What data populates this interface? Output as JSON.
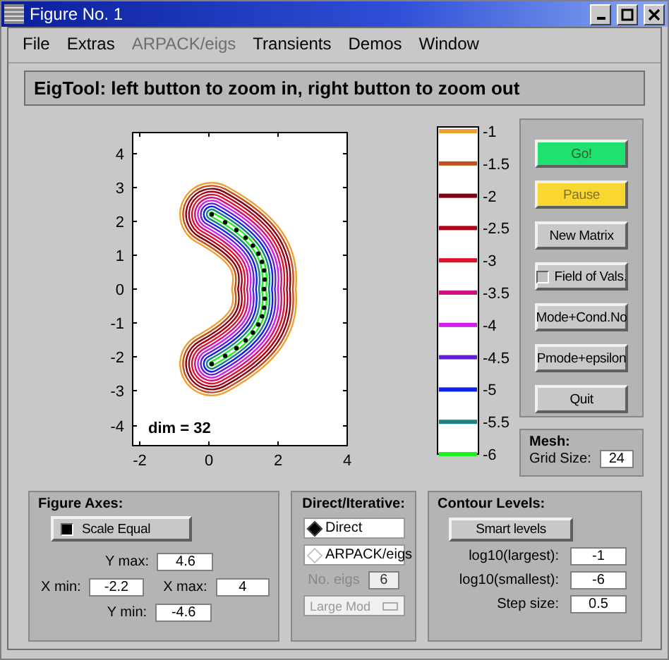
{
  "window": {
    "title": "Figure No. 1"
  },
  "menu": [
    {
      "label": "File",
      "disabled": false
    },
    {
      "label": "Extras",
      "disabled": false
    },
    {
      "label": "ARPACK/eigs",
      "disabled": true
    },
    {
      "label": "Transients",
      "disabled": false
    },
    {
      "label": "Demos",
      "disabled": false
    },
    {
      "label": "Window",
      "disabled": false
    }
  ],
  "header": "EigTool: left button to zoom in, right button to zoom out",
  "plot": {
    "xticks": [
      "-2",
      "0",
      "2",
      "4"
    ],
    "yticks": [
      "4",
      "3",
      "2",
      "1",
      "0",
      "-1",
      "-2",
      "-3",
      "-4"
    ],
    "annotation": "dim = 32"
  },
  "colorbar": [
    {
      "label": "-1",
      "color": "#f0a030"
    },
    {
      "label": "-1.5",
      "color": "#c05020"
    },
    {
      "label": "-2",
      "color": "#800010"
    },
    {
      "label": "-2.5",
      "color": "#b00018"
    },
    {
      "label": "-3",
      "color": "#e01028"
    },
    {
      "label": "-3.5",
      "color": "#d01080"
    },
    {
      "label": "-4",
      "color": "#d020e8"
    },
    {
      "label": "-4.5",
      "color": "#6020d0"
    },
    {
      "label": "-5",
      "color": "#1020e8"
    },
    {
      "label": "-5.5",
      "color": "#208080"
    },
    {
      "label": "-6",
      "color": "#20f020"
    }
  ],
  "controls": [
    {
      "label": "Go!",
      "kind": "go"
    },
    {
      "label": "Pause",
      "kind": "pause"
    },
    {
      "label": "New Matrix",
      "kind": "plain"
    },
    {
      "label": "Field of Vals.",
      "kind": "toggle",
      "checked": false
    },
    {
      "label": "Mode+Cond.No",
      "kind": "plain"
    },
    {
      "label": "Pmode+epsilon",
      "kind": "plain"
    },
    {
      "label": "Quit",
      "kind": "plain"
    }
  ],
  "mesh": {
    "title": "Mesh:",
    "label": "Grid Size:",
    "value": "24"
  },
  "figure_axes": {
    "title": "Figure Axes:",
    "scale_equal": {
      "label": "Scale Equal",
      "checked": true
    },
    "ymax": {
      "label": "Y max:",
      "value": "4.6"
    },
    "xmin": {
      "label": "X min:",
      "value": "-2.2"
    },
    "xmax": {
      "label": "X max:",
      "value": "4"
    },
    "ymin": {
      "label": "Y min:",
      "value": "-4.6"
    }
  },
  "direct_iterative": {
    "title": "Direct/Iterative:",
    "options": [
      {
        "label": "Direct",
        "selected": true
      },
      {
        "label": "ARPACK/eigs",
        "selected": false
      }
    ],
    "no_eigs": {
      "label": "No. eigs",
      "value": "6",
      "disabled": true
    },
    "which": {
      "label": "Large Mod",
      "disabled": true
    }
  },
  "contour_levels": {
    "title": "Contour Levels:",
    "button": "Smart  levels",
    "fields": [
      {
        "label": "log10(largest):",
        "value": "-1"
      },
      {
        "label": "log10(smallest):",
        "value": "-6"
      },
      {
        "label": "Step size:",
        "value": "0.5"
      }
    ]
  }
}
